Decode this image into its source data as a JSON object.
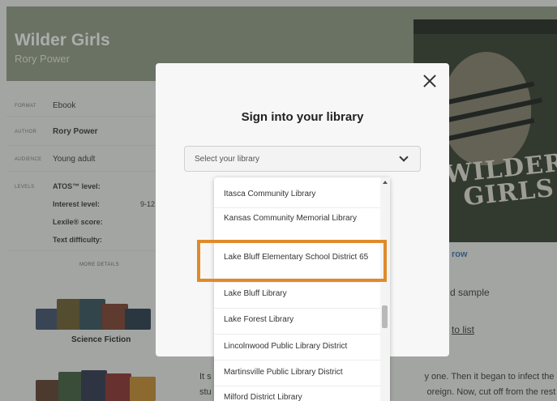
{
  "book": {
    "title": "Wilder Girls",
    "author_subtitle": "Rory Power"
  },
  "details": {
    "format_label": "FORMAT",
    "format_value": "Ebook",
    "author_label": "AUTHOR",
    "author_value": "Rory Power",
    "audience_label": "AUDIENCE",
    "audience_value": "Young adult",
    "levels_label": "LEVELS",
    "atos_label": "ATOS™ level:",
    "interest_label": "Interest level:",
    "interest_value": "9-12",
    "lexile_label": "Lexile® score:",
    "difficulty_label": "Text difficulty:",
    "more_details": "MORE DETAILS"
  },
  "genre": {
    "label": "Science Fiction"
  },
  "cover": {
    "title_line1": "WILDER",
    "title_line2": "GIRLS"
  },
  "right_side": {
    "borrow_fragment": "row",
    "sample_fragment": "d sample",
    "list_fragment": "to list"
  },
  "description": {
    "line1": "It s                                                                                      y one. Then it began to infect the",
    "line2": "stu                                                                                       oreign. Now, cut off from the rest of th"
  },
  "modal": {
    "title": "Sign into your library",
    "select_placeholder": "Select your library"
  },
  "libraries": [
    "Itasca Community Library",
    "Kansas Community Memorial Library",
    "Lake Bluff Elementary School District 65",
    "Lake Bluff Library",
    "Lake Forest Library",
    "Lincolnwood Public Library District",
    "Martinsville Public Library District",
    "Milford District Library"
  ],
  "colors": {
    "highlight": "#e08a2a",
    "hero": "#8f9a84"
  }
}
